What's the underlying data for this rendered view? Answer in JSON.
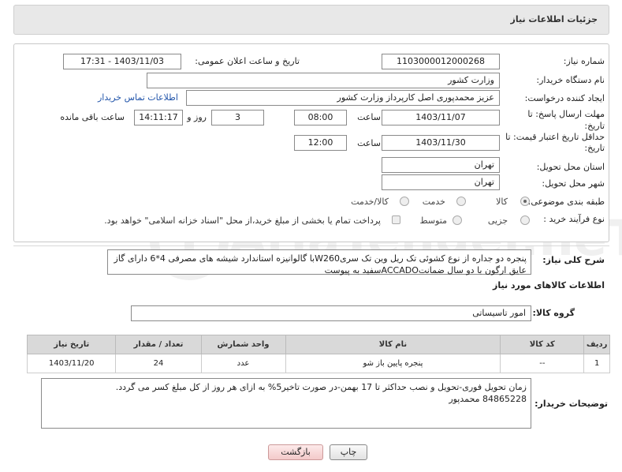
{
  "header": {
    "title": "جزئیات اطلاعات نیاز"
  },
  "fields": {
    "need_number_label": "شماره نیاز:",
    "need_number": "1103000012000268",
    "announce_label": "تاریخ و ساعت اعلان عمومی:",
    "announce_value": "1403/11/03 - 17:31",
    "buyer_org_label": "نام دستگاه خریدار:",
    "buyer_org": "وزارت کشور",
    "creator_label": "ایجاد کننده درخواست:",
    "creator": "عزیز محمدپوری اصل کارپرداز وزارت کشور",
    "contact_link": "اطلاعات تماس خریدار",
    "deadline_label_1": "مهلت ارسال پاسخ: تا",
    "deadline_label_2": "تاریخ:",
    "deadline_date": "1403/11/07",
    "time_label": "ساعت",
    "deadline_time": "08:00",
    "days_value": "3",
    "days_label": "روز و",
    "remaining_time": "14:11:17",
    "remaining_label": "ساعت باقی مانده",
    "validity_label_1": "حداقل تاریخ اعتبار قیمت: تا",
    "validity_label_2": "تاریخ:",
    "validity_date": "1403/11/30",
    "validity_time": "12:00",
    "province_label": "استان محل تحویل:",
    "province": "تهران",
    "city_label": "شهر محل تحویل:",
    "city": "تهران",
    "category_label": "طبقه بندی موضوعی:",
    "category_options": [
      "کالا",
      "خدمت",
      "کالا/خدمت"
    ],
    "process_label": "نوع فرآیند خرید :",
    "process_options": [
      "جزیی",
      "متوسط"
    ],
    "payment_note": "پرداخت تمام یا بخشی از مبلغ خرید،از محل \"اسناد خزانه اسلامی\" خواهد بود."
  },
  "description": {
    "label": "شرح کلی نیاز:",
    "text": "پنجره دو جداره از نوع کشوئی تک ریل وین تک سریW260با گالوانیزه استاندارد شیشه های مصرفی 4*6 دارای گاز عایق ارگون با دو سال ضمانتACCADOسفید به پیوست"
  },
  "goods_section": {
    "title": "اطلاعات کالاهای مورد نیاز",
    "group_label": "گروه کالا:",
    "group_value": "امور تاسیساتی"
  },
  "table": {
    "headers": [
      "ردیف",
      "کد کالا",
      "نام کالا",
      "واحد شمارش",
      "تعداد / مقدار",
      "تاریخ نیاز"
    ],
    "rows": [
      [
        "1",
        "--",
        "پنجره پایین باز شو",
        "عدد",
        "24",
        "1403/11/20"
      ]
    ]
  },
  "buyer_notes": {
    "label": "توضیحات خریدار:",
    "line1": "زمان تحویل فوری-تحویل و نصب حداکثر تا 17 بهمن-در صورت تاخیر5% به ازای هر روز از کل مبلغ کسر می گردد.",
    "line2": "84865228 محمدپور"
  },
  "buttons": {
    "print": "چاپ",
    "back": "بازگشت"
  },
  "watermark": {
    "text": "AriaTender.neT"
  }
}
